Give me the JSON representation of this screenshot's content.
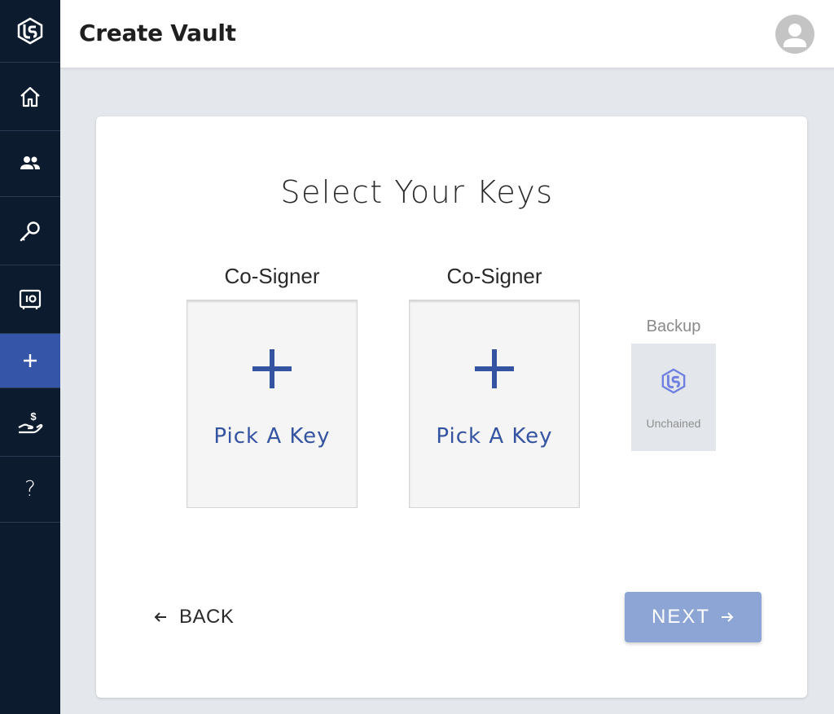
{
  "header": {
    "title": "Create Vault"
  },
  "sidebar": {
    "items": [
      {
        "icon": "home-icon"
      },
      {
        "icon": "users-icon"
      },
      {
        "icon": "key-icon"
      },
      {
        "icon": "vault-icon"
      },
      {
        "icon": "plus-icon",
        "active": true
      },
      {
        "icon": "hand-dollar-icon"
      },
      {
        "icon": "help-icon",
        "glyph": "?"
      }
    ]
  },
  "main": {
    "title": "Select Your Keys",
    "slots": [
      {
        "role": "Co-Signer",
        "action": "Pick A Key"
      },
      {
        "role": "Co-Signer",
        "action": "Pick A Key"
      }
    ],
    "backup": {
      "role": "Backup",
      "name": "Unchained"
    },
    "back_label": "BACK",
    "next_label": "NEXT"
  },
  "colors": {
    "sidebar_bg": "#0d1b2e",
    "active_nav": "#3455a8",
    "accent": "#3453a0",
    "next_disabled": "#8ca5d4",
    "page_bg": "#e4e7eb"
  }
}
